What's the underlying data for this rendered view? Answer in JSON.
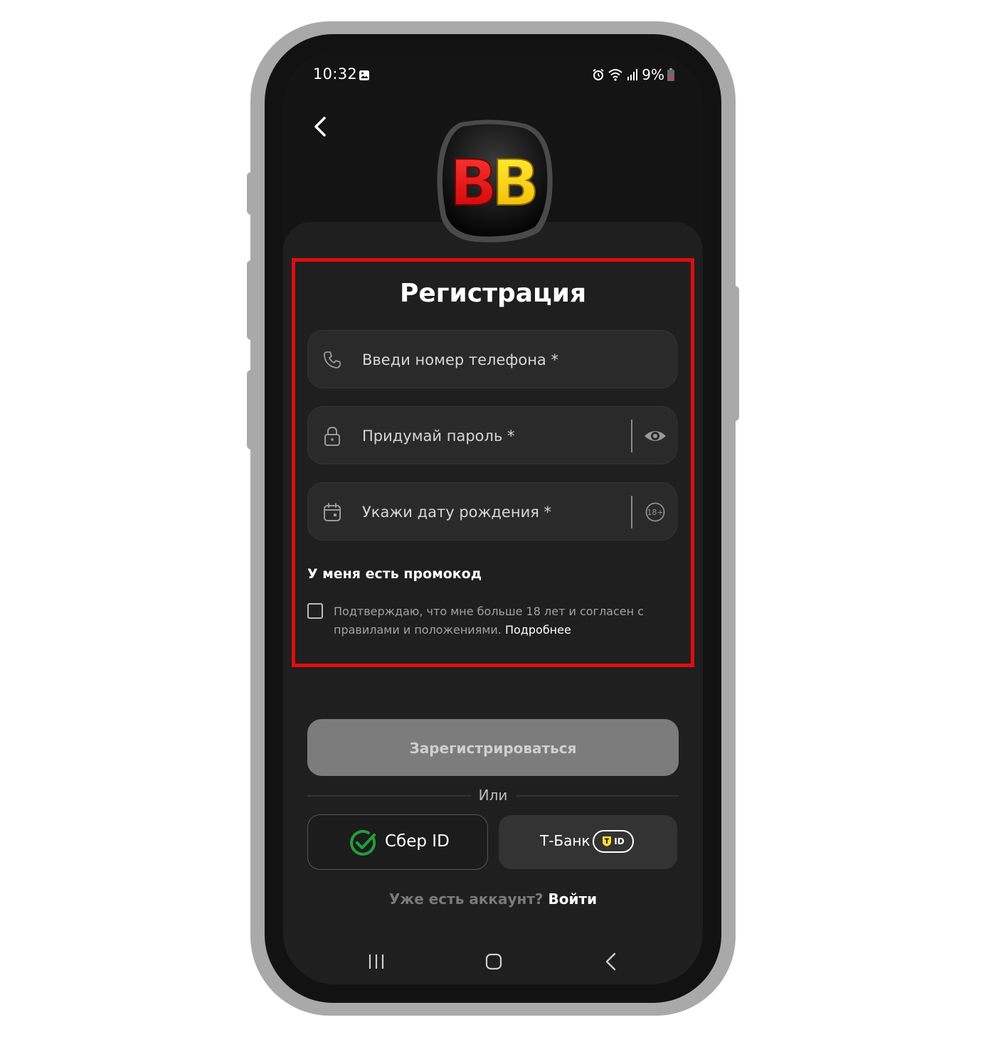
{
  "status_bar": {
    "time": "10:32",
    "battery": "9%"
  },
  "icons": {
    "back": "back-arrow-icon",
    "phone": "phone-icon",
    "lock": "lock-icon",
    "calendar": "calendar-icon",
    "eye": "eye-icon",
    "age": "age-18-plus-icon",
    "sber": "sber-check-icon",
    "tbank": "tbank-shield-icon"
  },
  "logo": {
    "text": "BB"
  },
  "form": {
    "title": "Регистрация",
    "phone_placeholder": "Введи номер телефона *",
    "password_placeholder": "Придумай пароль *",
    "birthdate_placeholder": "Укажи дату рождения *",
    "age_badge": "18+",
    "promo_label": "У меня есть промокод",
    "consent_text": "Подтверждаю, что мне больше 18 лет и согласен с правилами и положениями.",
    "consent_link": "Подробнее"
  },
  "actions": {
    "register_label": "Зарегистрироваться",
    "or_label": "Или",
    "sber_label": "Сбер ID",
    "tbank_label": "Т-Банк",
    "tbank_badge": "ID",
    "login_prompt": "Уже есть аккаунт?",
    "login_link": "Войти"
  },
  "colors": {
    "background": "#141414",
    "card": "#1f1f1f",
    "field": "#2a2a2a",
    "highlight": "#e00d0d",
    "register_button": "#7c7c7c",
    "sber_green": "#21a038",
    "tbank_yellow": "#ffdd2d"
  }
}
